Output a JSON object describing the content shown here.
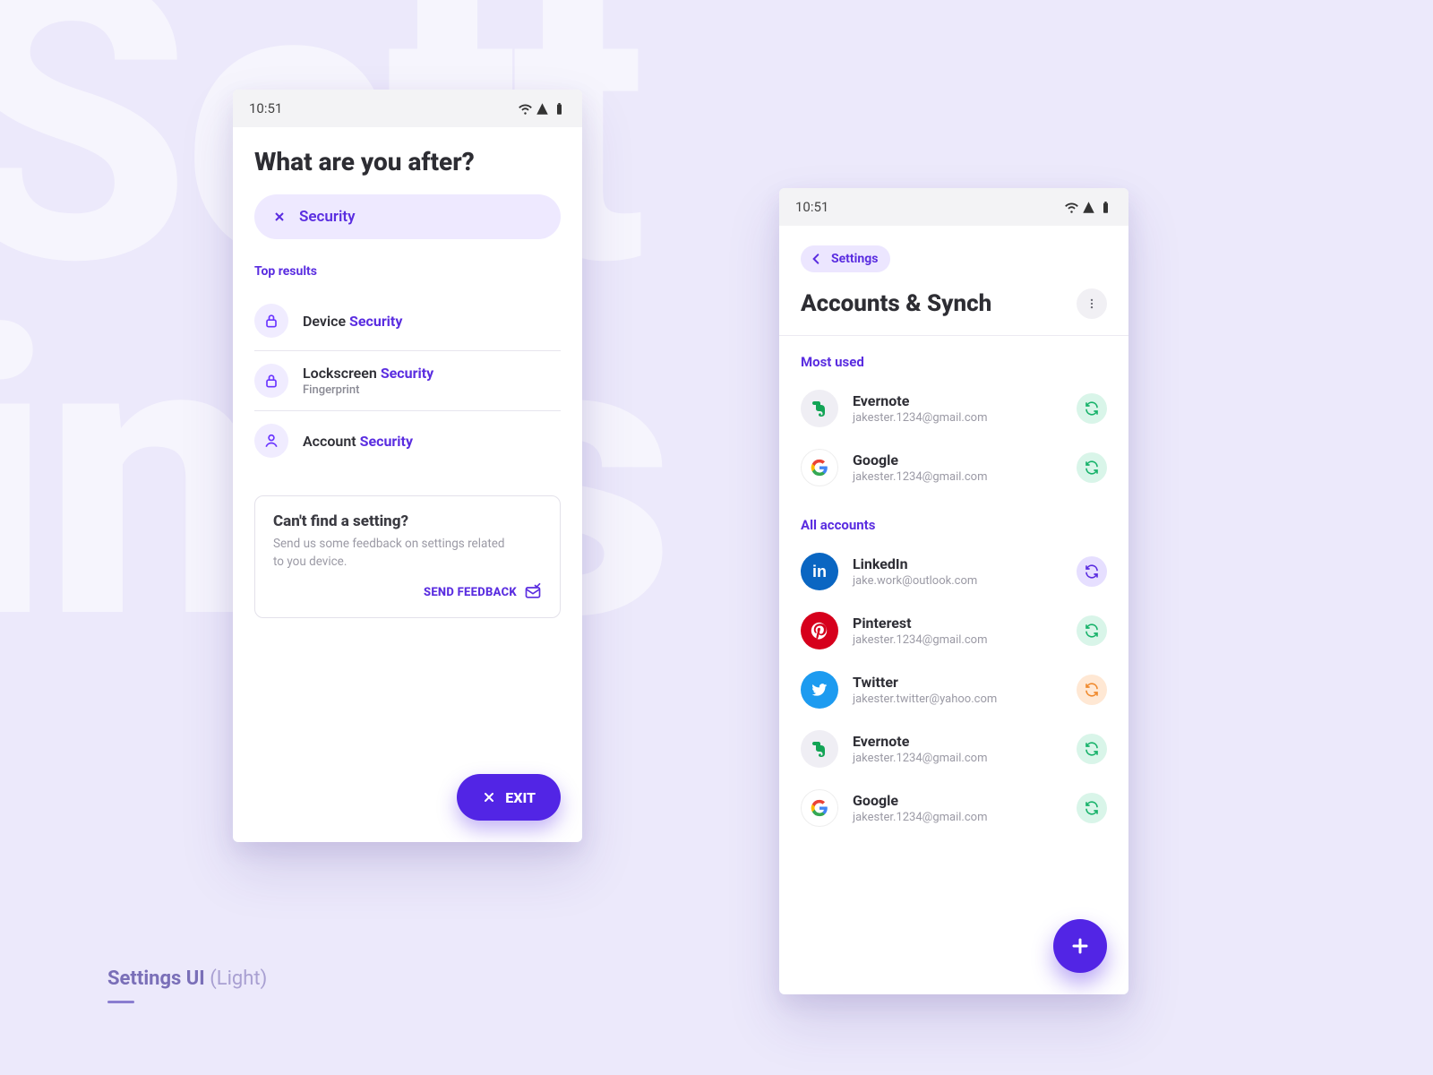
{
  "caption": {
    "strong": "Settings UI",
    "light": " (Light)"
  },
  "statusbar": {
    "time": "10:51"
  },
  "left": {
    "title": "What are you after?",
    "search_value": "Security",
    "top_results_label": "Top results",
    "results": [
      {
        "prefix": "Device ",
        "highlight": "Security",
        "sub": "",
        "icon": "lock"
      },
      {
        "prefix": "Lockscreen ",
        "highlight": "Security",
        "sub": "Fingerprint",
        "icon": "lock"
      },
      {
        "prefix": "Account ",
        "highlight": "Security",
        "sub": "",
        "icon": "person"
      }
    ],
    "feedback": {
      "title": "Can't find a setting?",
      "body": "Send us some feedback on settings related to you device.",
      "cta": "SEND FEEDBACK"
    },
    "exit_label": "EXIT"
  },
  "right": {
    "back_label": "Settings",
    "title": "Accounts & Synch",
    "most_used_label": "Most used",
    "all_accounts_label": "All accounts",
    "most_used": [
      {
        "service": "Evernote",
        "email": "jakester.1234@gmail.com",
        "brand": "evernote",
        "sync": "green"
      },
      {
        "service": "Google",
        "email": "jakester.1234@gmail.com",
        "brand": "google",
        "sync": "green"
      }
    ],
    "all": [
      {
        "service": "LinkedIn",
        "email": "jake.work@outlook.com",
        "brand": "linkedin",
        "sync": "purple"
      },
      {
        "service": "Pinterest",
        "email": "jakester.1234@gmail.com",
        "brand": "pinterest",
        "sync": "green"
      },
      {
        "service": "Twitter",
        "email": "jakester.twitter@yahoo.com",
        "brand": "twitter",
        "sync": "orange"
      },
      {
        "service": "Evernote",
        "email": "jakester.1234@gmail.com",
        "brand": "evernote",
        "sync": "green"
      },
      {
        "service": "Google",
        "email": "jakester.1234@gmail.com",
        "brand": "google",
        "sync": "green"
      }
    ]
  }
}
